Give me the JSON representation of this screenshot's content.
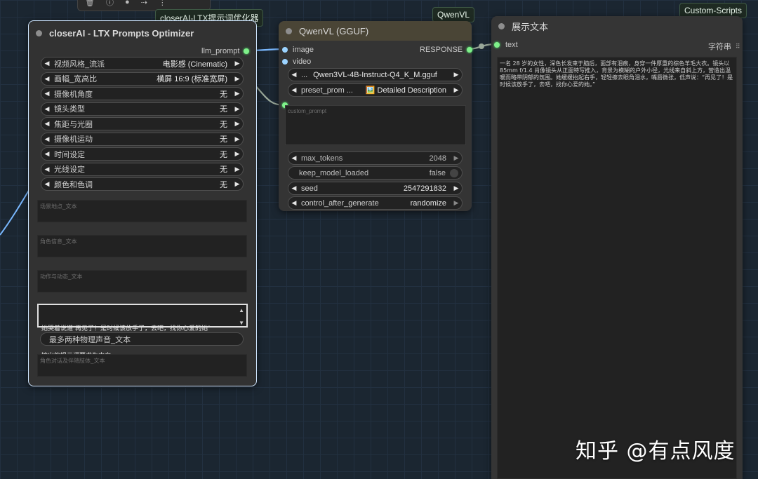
{
  "groups": {
    "optimizer_tag": "closerAI-LTX提示词优化器",
    "qwen_tag": "QwenVL",
    "scripts_tag": "Custom-Scripts"
  },
  "toolbar": {
    "icons": [
      "trash-icon",
      "info-icon",
      "color-icon",
      "bypass-icon",
      "fit-icon",
      "more-icon"
    ]
  },
  "optimizer": {
    "title": "closerAI - LTX Prompts Optimizer",
    "output": "llm_prompt",
    "widgets": [
      {
        "label": "视频风格_流派",
        "value": "电影感 (Cinematic)"
      },
      {
        "label": "画幅_宽高比",
        "value": "横屏 16:9 (标准宽屏)"
      },
      {
        "label": "摄像机角度",
        "value": "无"
      },
      {
        "label": "镜头类型",
        "value": "无"
      },
      {
        "label": "焦距与光圈",
        "value": "无"
      },
      {
        "label": "摄像机运动",
        "value": "无"
      },
      {
        "label": "时间设定",
        "value": "无"
      },
      {
        "label": "光线设定",
        "value": "无"
      },
      {
        "label": "颜色和色调",
        "value": "无"
      }
    ],
    "scene_placeholder": "场景地点_文本",
    "character_placeholder": "角色信息_文本",
    "action_placeholder": "动作与动态_文本",
    "dialogue_line1": "她哭着说道“再见了！是时候该放手了，去吧，找你心爱的她”",
    "dialogue_line2": "输出的提示词要求为中文",
    "sound_label": "最多两种物理声音_文本",
    "limb_placeholder": "角色对话及伴随肢体_文本"
  },
  "qwen": {
    "title": "QwenVL (GGUF)",
    "inputs": [
      "image",
      "video"
    ],
    "output": "RESPONSE",
    "model_prefix": "...",
    "model_value": "Qwen3VL-4B-Instruct-Q4_K_M.gguf",
    "preset_label": "preset_prom ...",
    "preset_value": "🖼️ Detailed Description",
    "custom_prompt_placeholder": "custom_prompt",
    "max_tokens_label": "max_tokens",
    "max_tokens_value": "2048",
    "keep_loaded_label": "keep_model_loaded",
    "keep_loaded_value": "false",
    "seed_label": "seed",
    "seed_value": "2547291832",
    "control_label": "control_after_generate",
    "control_value": "randomize"
  },
  "display": {
    "title": "展示文本",
    "input": "text",
    "type_label": "字符串",
    "content": "一名 28 岁的女性，深色长发束于脑后，面部有泪痕，身穿一件厚重的棕色羊毛大衣。镜头以 85mm f/1.4 肖像镜头从正面特写推入，背景为模糊的户外小径，光线来自斜上方，营造出温暖而略带阴郁的氛围。她缓缓抬起右手，轻轻擦去眼角泪水，嘴唇微张，低声说：“再见了！是时候该放手了，去吧，找你心爱的她。”"
  },
  "watermark": "知乎 @有点风度",
  "colors": {
    "canvas": "#1b2631",
    "node": "#353535",
    "selected_outline": "#cfe6ff",
    "wire_image": "#79b8ff",
    "wire_text": "#9aa89a",
    "slot_green": "#7ff08a"
  }
}
